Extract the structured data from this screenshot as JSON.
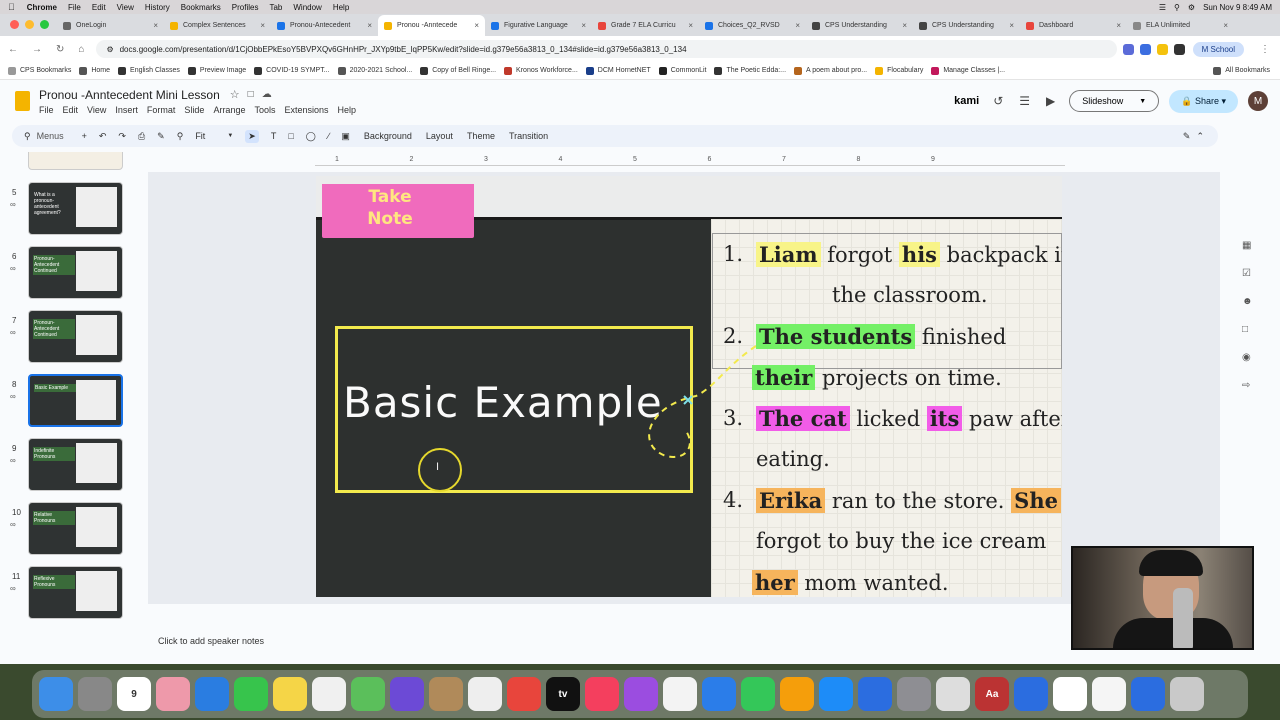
{
  "mac_menu": {
    "app": "Chrome",
    "items": [
      "File",
      "Edit",
      "View",
      "History",
      "Bookmarks",
      "Profiles",
      "Tab",
      "Window",
      "Help"
    ],
    "clock": "Sun Nov 9  8:49 AM"
  },
  "tabs": [
    {
      "label": "OneLogin",
      "color": "#666"
    },
    {
      "label": "Complex Sentences",
      "color": "#f4b400"
    },
    {
      "label": "Pronou-Antecedent",
      "color": "#1a73e8"
    },
    {
      "label": "Pronou -Anntecede",
      "color": "#f4b400",
      "active": true
    },
    {
      "label": "Figurative Language",
      "color": "#1a73e8"
    },
    {
      "label": "Grade 7 ELA Curricu",
      "color": "#e8453c"
    },
    {
      "label": "Choices_Q2_RVSD",
      "color": "#1a73e8"
    },
    {
      "label": "CPS Understanding",
      "color": "#444"
    },
    {
      "label": "CPS Understanding",
      "color": "#444"
    },
    {
      "label": "Dashboard",
      "color": "#e8453c"
    },
    {
      "label": "ELA Unlimited",
      "color": "#888"
    }
  ],
  "address": {
    "url": "docs.google.com/presentation/d/1CjObbEPkEsoY5BVPXQv6GHnHPr_JXYp9tbE_lqPP5Kw/edit?slide=id.g379e56a3813_0_134#slide=id.g379e56a3813_0_134",
    "profile": "School",
    "profile_initial": "M"
  },
  "bookmarks": [
    {
      "label": "CPS Bookmarks",
      "color": "#999"
    },
    {
      "label": "Home",
      "color": "#555"
    },
    {
      "label": "English Classes",
      "color": "#333"
    },
    {
      "label": "Preview Image",
      "color": "#333"
    },
    {
      "label": "COVID-19 SYMPT...",
      "color": "#333"
    },
    {
      "label": "2020-2021 School...",
      "color": "#555"
    },
    {
      "label": "Copy of Bell Ringe...",
      "color": "#333"
    },
    {
      "label": "Kronos Workforce...",
      "color": "#c0392b"
    },
    {
      "label": "DCM HornetNET",
      "color": "#1a3e8a"
    },
    {
      "label": "CommonLit",
      "color": "#222"
    },
    {
      "label": "The Poetic Edda:...",
      "color": "#333"
    },
    {
      "label": "A poem about pro...",
      "color": "#b5651d"
    },
    {
      "label": "Flocabulary",
      "color": "#f4b400"
    },
    {
      "label": "Manage Classes |...",
      "color": "#c2185b"
    },
    {
      "label": "All Bookmarks",
      "color": "#555"
    }
  ],
  "doc": {
    "title": "Pronou -Anntecedent Mini Lesson",
    "menus": [
      "File",
      "Edit",
      "View",
      "Insert",
      "Format",
      "Slide",
      "Arrange",
      "Tools",
      "Extensions",
      "Help"
    ],
    "kami": "kami",
    "slideshow": "Slideshow",
    "share": "Share",
    "avatar": "M"
  },
  "toolbar": {
    "search": "Menus",
    "zoom": "Fit",
    "background": "Background",
    "layout": "Layout",
    "theme": "Theme",
    "transition": "Transition"
  },
  "ruler_ticks": [
    "1",
    "2",
    "3",
    "4",
    "5",
    "6",
    "7",
    "8",
    "9"
  ],
  "thumbnails": [
    {
      "num": "5",
      "text": "What is a pronoun-antecedent agreement?"
    },
    {
      "num": "6",
      "text": "Pronoun-Antecedent Continued"
    },
    {
      "num": "7",
      "text": "Pronoun-Antecedent Continued"
    },
    {
      "num": "8",
      "text": "Basic Example",
      "selected": true
    },
    {
      "num": "9",
      "text": "Indefinite Pronouns"
    },
    {
      "num": "10",
      "text": "Relative Pronouns"
    },
    {
      "num": "11",
      "text": "Reflexive Pronouns"
    }
  ],
  "slide": {
    "take_note": "Take Note",
    "heading": "Basic Example",
    "examples": [
      {
        "num": "1.",
        "l1": [
          {
            "t": "Liam",
            "c": "y"
          },
          {
            "t": " forgot "
          },
          {
            "t": "his",
            "c": "y"
          },
          {
            "t": " backpack in"
          }
        ],
        "l2": "the classroom."
      },
      {
        "num": "2.",
        "l1": [
          {
            "t": "The students",
            "c": "g"
          },
          {
            "t": " finished"
          }
        ],
        "l2p": [
          {
            "t": "their",
            "c": "g"
          },
          {
            "t": " projects on time."
          }
        ]
      },
      {
        "num": "3.",
        "l1": [
          {
            "t": "The cat",
            "c": "m"
          },
          {
            "t": " licked "
          },
          {
            "t": "its",
            "c": "m"
          },
          {
            "t": " paw after"
          }
        ],
        "l2": "eating."
      },
      {
        "num": "4.",
        "l1": [
          {
            "t": "Erika",
            "c": "o"
          },
          {
            "t": " ran to the store. "
          },
          {
            "t": "She",
            "c": "o"
          }
        ],
        "l2": "forgot to buy the ice cream",
        "l3p": [
          {
            "t": "her",
            "c": "o"
          },
          {
            "t": " mom wanted."
          }
        ]
      }
    ]
  },
  "notes": "Click to add speaker notes",
  "dock": [
    {
      "label": "Finder",
      "color": "#3d8ee8"
    },
    {
      "label": "Launchpad",
      "color": "#888"
    },
    {
      "label": "Calendar",
      "color": "#fff",
      "text": "9"
    },
    {
      "label": "Photos",
      "color": "#e9a"
    },
    {
      "label": "Safari",
      "color": "#2a7de1"
    },
    {
      "label": "Messages",
      "color": "#37c44c"
    },
    {
      "label": "Notes",
      "color": "#f5d547"
    },
    {
      "label": "Freeform",
      "color": "#f0f0f0"
    },
    {
      "label": "Maps",
      "color": "#5bbf5b"
    },
    {
      "label": "Superstar",
      "color": "#6c4ad6"
    },
    {
      "label": "Contacts",
      "color": "#b08a5a"
    },
    {
      "label": "Reminders",
      "color": "#eee"
    },
    {
      "label": "Chrome",
      "color": "#e8453c"
    },
    {
      "label": "TV",
      "color": "#111",
      "text": "tv"
    },
    {
      "label": "Music",
      "color": "#f43f5e"
    },
    {
      "label": "Podcasts",
      "color": "#9b4de0"
    },
    {
      "label": "News",
      "color": "#f3f3f3"
    },
    {
      "label": "Keynote",
      "color": "#2b7de9"
    },
    {
      "label": "Numbers",
      "color": "#34c759"
    },
    {
      "label": "Pages",
      "color": "#f59e0b"
    },
    {
      "label": "App Store",
      "color": "#1d8cf8"
    },
    {
      "label": "App",
      "color": "#2b6de0"
    },
    {
      "label": "System Settings",
      "color": "#8e8e93"
    },
    {
      "label": "Preview",
      "color": "#ddd"
    },
    {
      "label": "Dictionary",
      "color": "#b33",
      "text": "Aa"
    },
    {
      "label": "App",
      "color": "#2b6de0"
    },
    {
      "label": "Drive",
      "color": "#fff"
    },
    {
      "label": "File",
      "color": "#f5f5f5"
    },
    {
      "label": "App",
      "color": "#2b6de0"
    },
    {
      "label": "Trash",
      "color": "#c9c9c9"
    }
  ]
}
